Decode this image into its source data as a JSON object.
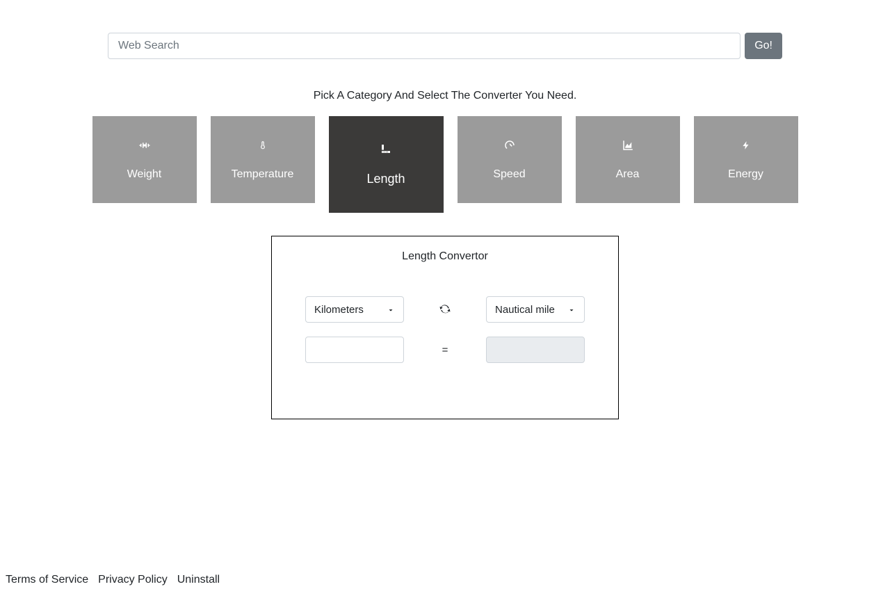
{
  "search": {
    "placeholder": "Web Search",
    "go_label": "Go!"
  },
  "instruction": "Pick A Category And Select The Converter You Need.",
  "categories": [
    {
      "label": "Weight",
      "active": false
    },
    {
      "label": "Temperature",
      "active": false
    },
    {
      "label": "Length",
      "active": true
    },
    {
      "label": "Speed",
      "active": false
    },
    {
      "label": "Area",
      "active": false
    },
    {
      "label": "Energy",
      "active": false
    }
  ],
  "converter": {
    "title": "Length Convertor",
    "from_unit": "Kilometers",
    "to_unit": "Nautical mile",
    "from_value": "",
    "to_value": "",
    "equals": "="
  },
  "footer": {
    "tos": "Terms of Service",
    "privacy": "Privacy Policy",
    "uninstall": "Uninstall"
  }
}
